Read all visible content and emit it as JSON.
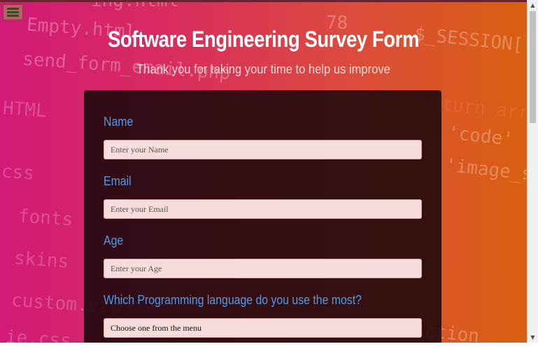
{
  "page": {
    "title": "Software Engineering Survey Form",
    "subtitle": "Thank you for taking your time to help us improve"
  },
  "nav": {
    "menu_icon": "hamburger-menu-icon"
  },
  "form": {
    "name": {
      "label": "Name",
      "placeholder": "Enter your Name"
    },
    "email": {
      "label": "Email",
      "placeholder": "Enter your Email"
    },
    "age": {
      "label": "Age",
      "placeholder": "Enter your Age"
    },
    "language": {
      "label": "Which Programming language do you use the most?",
      "selected": "Choose one from the menu"
    }
  },
  "background": {
    "code_lines": [
      "Empty.html",
      "send_form_email.php",
      "HTML",
      "css",
      "fonts",
      "skins",
      "custom.css",
      "ie.css",
      "$_SESSION[",
      "return arra",
      "'code'",
      "'image_s",
      "78",
      "function",
      "ing.html"
    ]
  },
  "colors": {
    "accent_label": "#4f9be8",
    "gradient_left": "#d21a78",
    "gradient_right": "#d9600f",
    "card_bg": "#1c080a",
    "input_bg": "#f6dcdc"
  }
}
